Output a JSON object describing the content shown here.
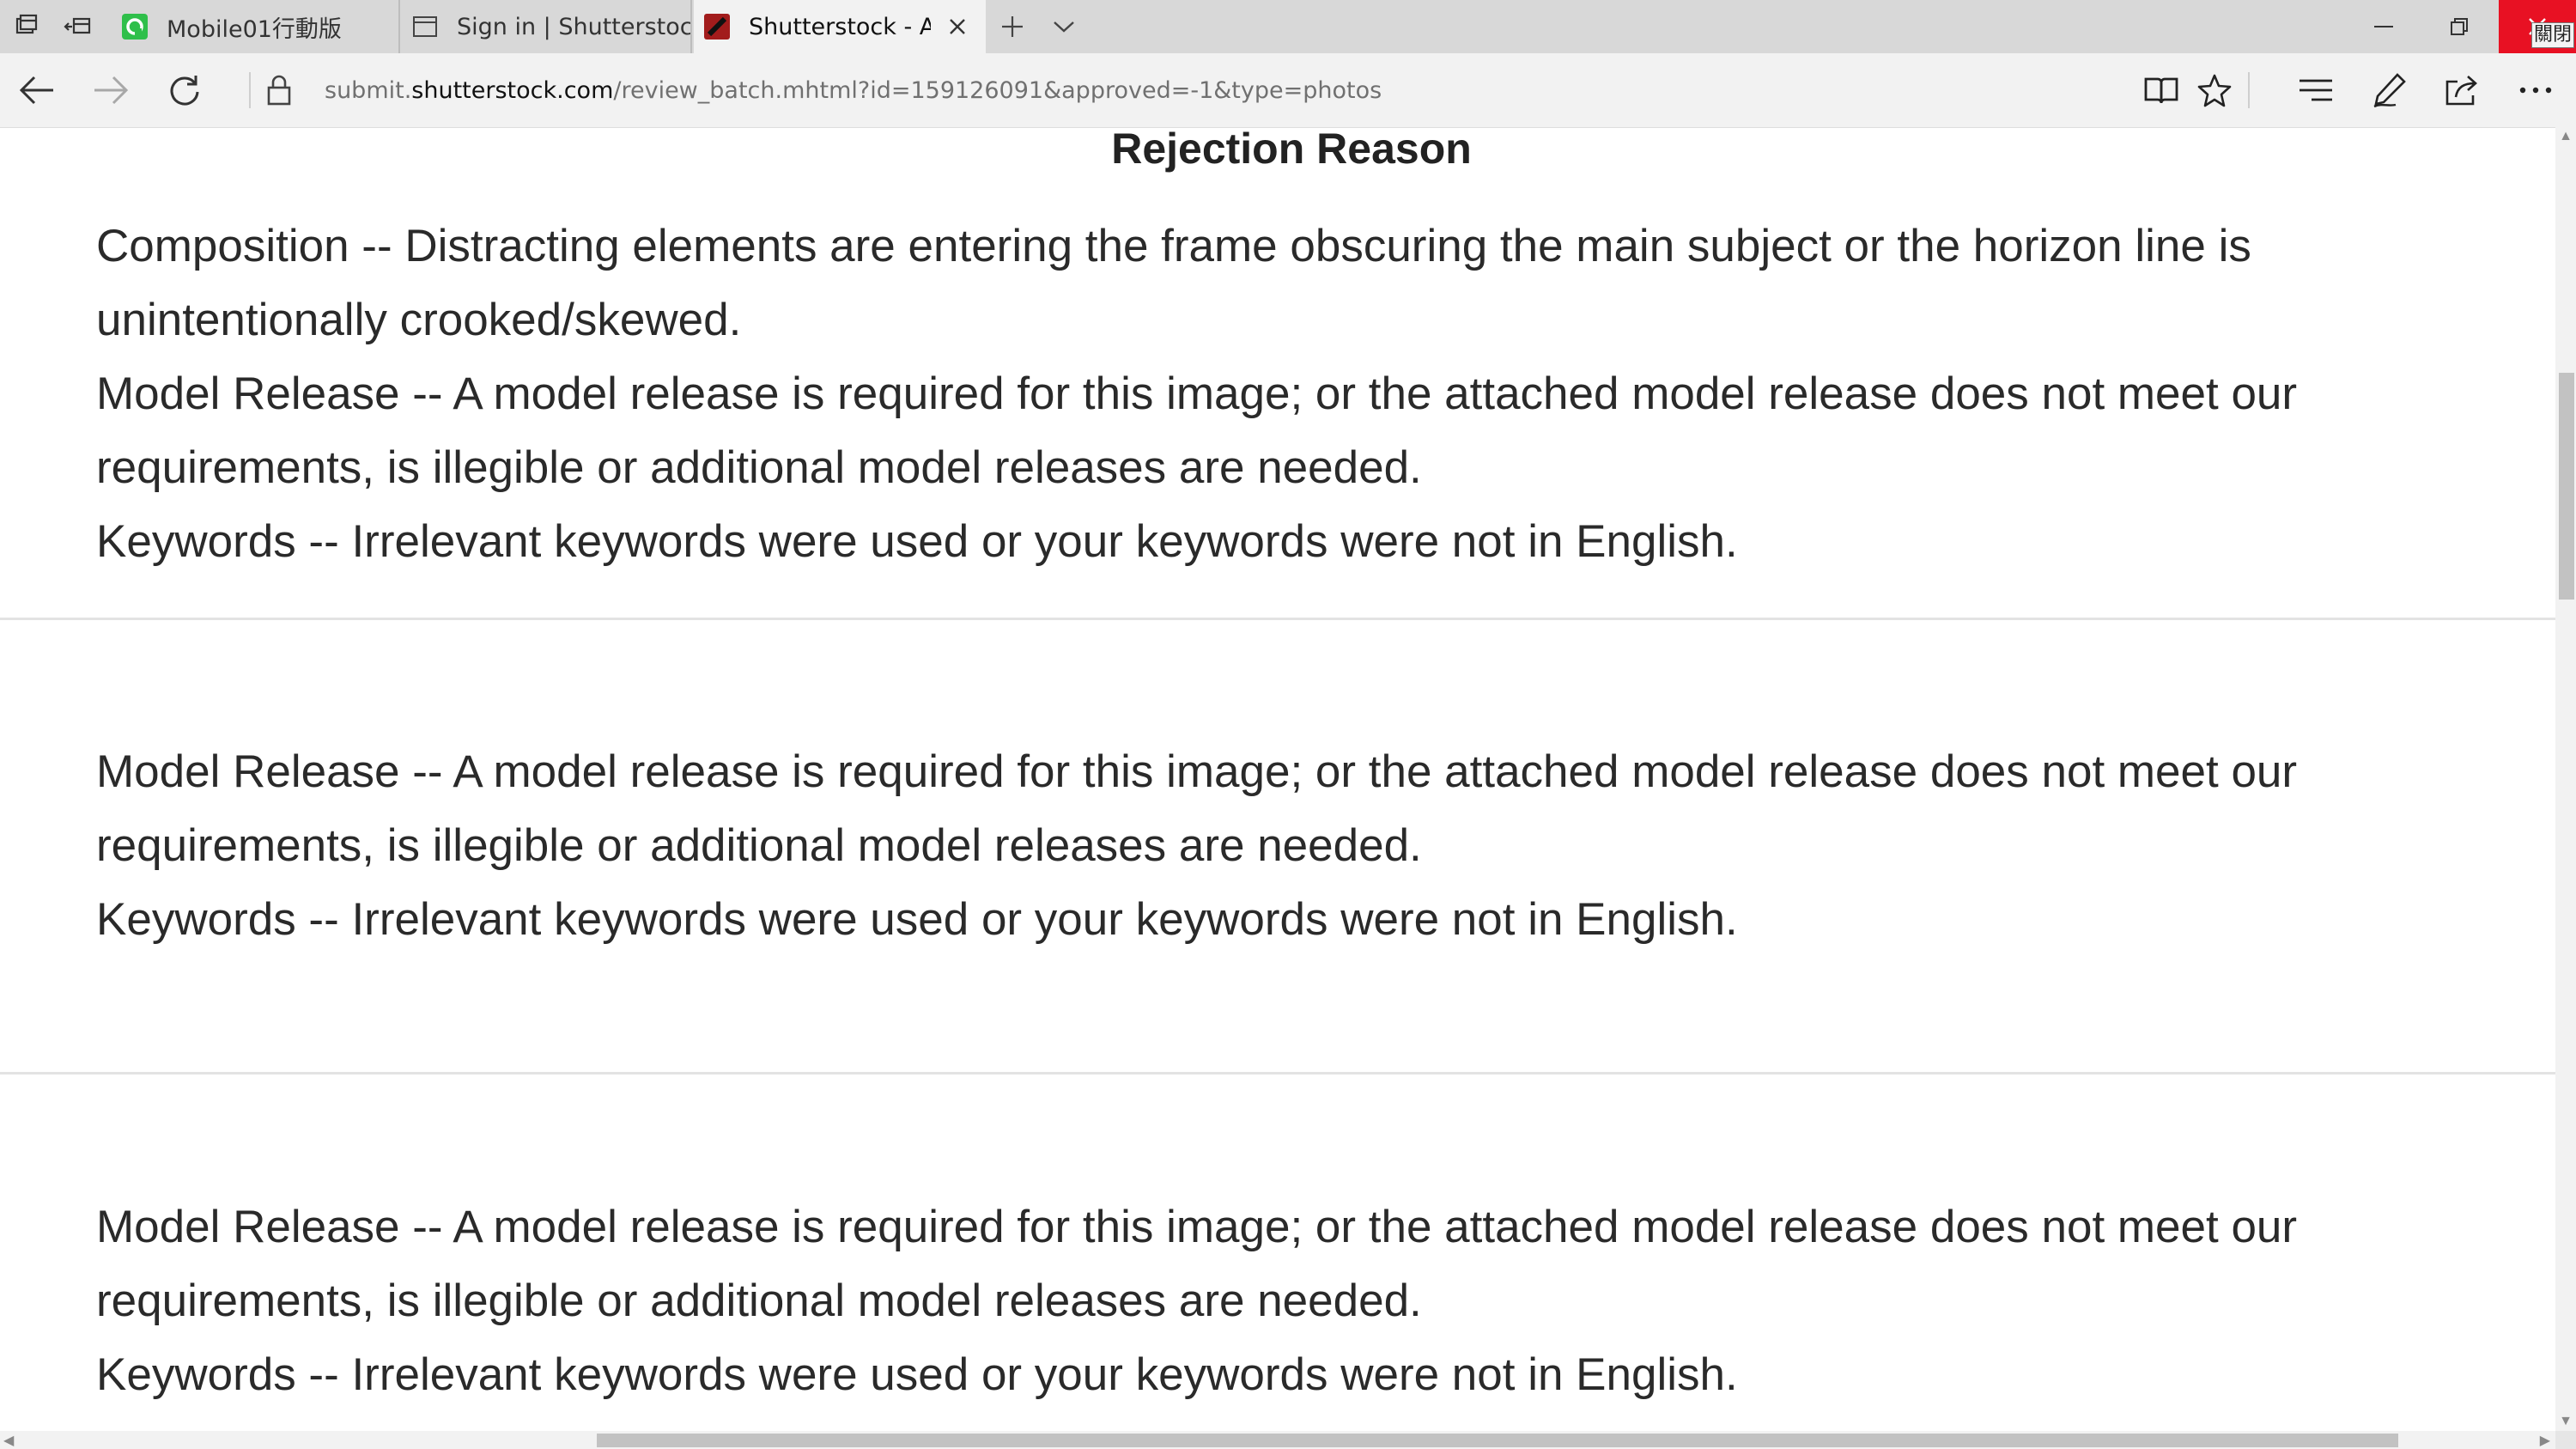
{
  "browser": {
    "tabs": [
      {
        "title": "Mobile01行動版",
        "active": false,
        "icon": "mobile01-favicon"
      },
      {
        "title": "Sign in | Shutterstock",
        "active": false,
        "icon": "page-icon"
      },
      {
        "title": "Shutterstock - Appr",
        "active": true,
        "icon": "shutterstock-favicon"
      }
    ],
    "close_tooltip": "關閉",
    "url": {
      "prefix": "submit.",
      "host": "shutterstock.com",
      "path": "/review_batch.mhtml?id=159126091&approved=-1&type=photos"
    },
    "colors": {
      "tabstrip": "#d8d8d8",
      "toolbar": "#f2f2f2",
      "close_red": "#e81123"
    }
  },
  "page": {
    "heading": "Rejection Reason",
    "blocks": [
      {
        "reasons": [
          "Composition -- Distracting elements are entering the frame obscuring the main subject or the horizon line is unintentionally crooked/skewed.",
          "Model Release -- A model release is required for this image; or the attached model release does not meet our requirements, is illegible or additional model releases are needed.",
          "Keywords -- Irrelevant keywords were used or your keywords were not in English."
        ]
      },
      {
        "reasons": [
          "Model Release -- A model release is required for this image; or the attached model release does not meet our requirements, is illegible or additional model releases are needed.",
          "Keywords -- Irrelevant keywords were used or your keywords were not in English."
        ]
      },
      {
        "reasons": [
          "Model Release -- A model release is required for this image; or the attached model release does not meet our requirements, is illegible or additional model releases are needed.",
          "Keywords -- Irrelevant keywords were used or your keywords were not in English."
        ]
      }
    ]
  }
}
